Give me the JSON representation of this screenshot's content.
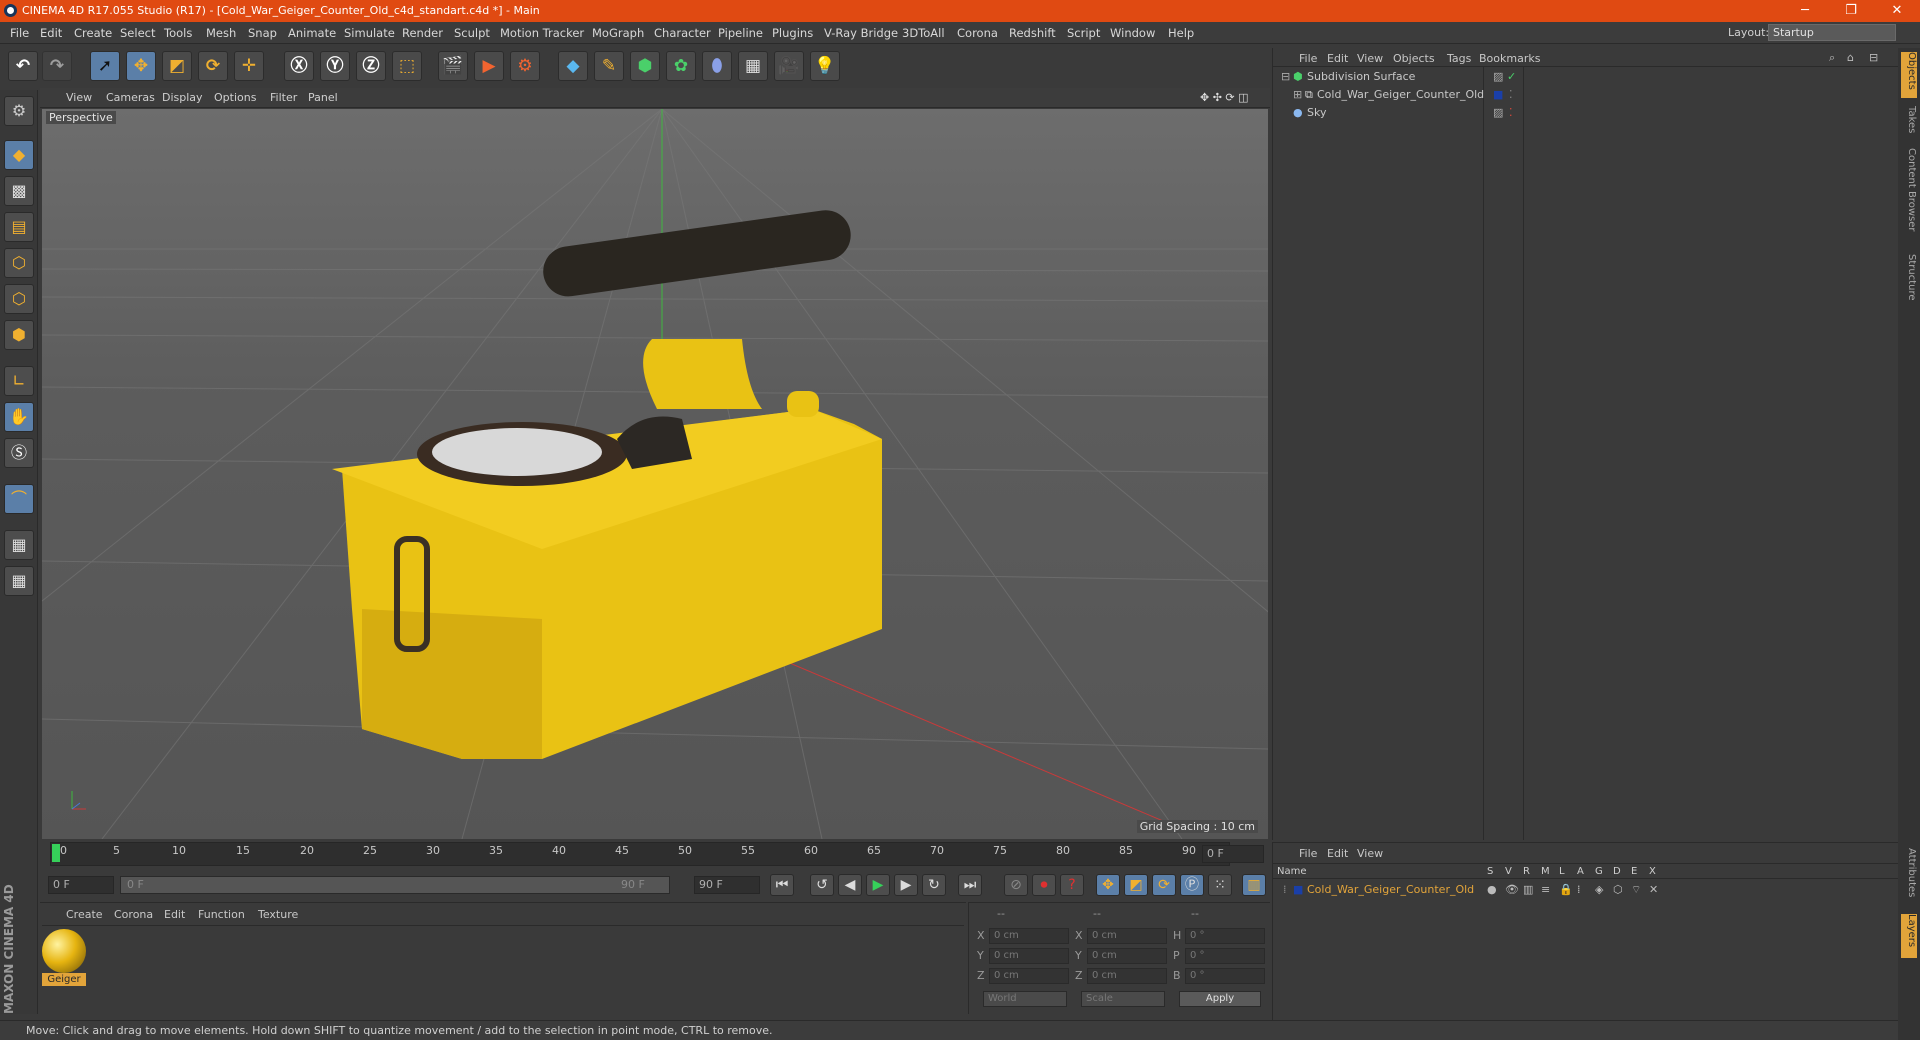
{
  "window": {
    "title": "CINEMA 4D R17.055 Studio (R17) - [Cold_War_Geiger_Counter_Old_c4d_standart.c4d *] - Main",
    "minimize": "─",
    "maximize": "❐",
    "close": "✕"
  },
  "menu": [
    "File",
    "Edit",
    "Create",
    "Select",
    "Tools",
    "Mesh",
    "Snap",
    "Animate",
    "Simulate",
    "Render",
    "Sculpt",
    "Motion Tracker",
    "MoGraph",
    "Character",
    "Pipeline",
    "Plugins",
    "V-Ray Bridge",
    "3DToAll",
    "Corona",
    "Redshift",
    "Script",
    "Window",
    "Help"
  ],
  "layout": {
    "label": "Layout:",
    "value": "Startup"
  },
  "viewport": {
    "menu": [
      "View",
      "Cameras",
      "Display",
      "Options",
      "Filter",
      "Panel"
    ],
    "camera": "Perspective",
    "grid_spacing": "Grid Spacing : 10 cm"
  },
  "timeline": {
    "ticks": [
      "0",
      "5",
      "10",
      "15",
      "20",
      "25",
      "30",
      "35",
      "40",
      "45",
      "50",
      "55",
      "60",
      "65",
      "70",
      "75",
      "80",
      "85",
      "90"
    ],
    "current": "0 F",
    "start": "0 F",
    "range_start": "0 F",
    "range_end": "90 F",
    "end": "90 F"
  },
  "material": {
    "menu": [
      "Create",
      "Corona",
      "Edit",
      "Function",
      "Texture"
    ],
    "items": [
      {
        "name": "Geiger"
      }
    ]
  },
  "coords": {
    "header": [
      "--",
      "--",
      "--"
    ],
    "rows": [
      {
        "a": "X",
        "av": "0 cm",
        "b": "X",
        "bv": "0 cm",
        "c": "H",
        "cv": "0 °"
      },
      {
        "a": "Y",
        "av": "0 cm",
        "b": "Y",
        "bv": "0 cm",
        "c": "P",
        "cv": "0 °"
      },
      {
        "a": "Z",
        "av": "0 cm",
        "b": "Z",
        "bv": "0 cm",
        "c": "B",
        "cv": "0 °"
      }
    ],
    "world": "World",
    "scale": "Scale",
    "apply": "Apply"
  },
  "objects": {
    "menu": [
      "File",
      "Edit",
      "View",
      "Objects",
      "Tags",
      "Bookmarks"
    ],
    "items": [
      {
        "name": "Subdivision Surface",
        "color": "#c8c8c8"
      },
      {
        "name": "Cold_War_Geiger_Counter_Old",
        "color": "#c8c8c8"
      },
      {
        "name": "Sky",
        "color": "#c8c8c8"
      }
    ]
  },
  "layers": {
    "menu": [
      "File",
      "Edit",
      "View"
    ],
    "columns": [
      "Name",
      "S",
      "V",
      "R",
      "M",
      "L",
      "A",
      "G",
      "D",
      "E",
      "X"
    ],
    "items": [
      {
        "name": "Cold_War_Geiger_Counter_Old",
        "color": "#e2a43a"
      }
    ]
  },
  "right_tabs": [
    "Objects",
    "Takes",
    "Content Browser",
    "Structure",
    "Attributes",
    "Layers"
  ],
  "brand": "MAXON CINEMA 4D",
  "status": "Move: Click and drag to move elements. Hold down SHIFT to quantize movement / add to the selection in point mode, CTRL to remove."
}
